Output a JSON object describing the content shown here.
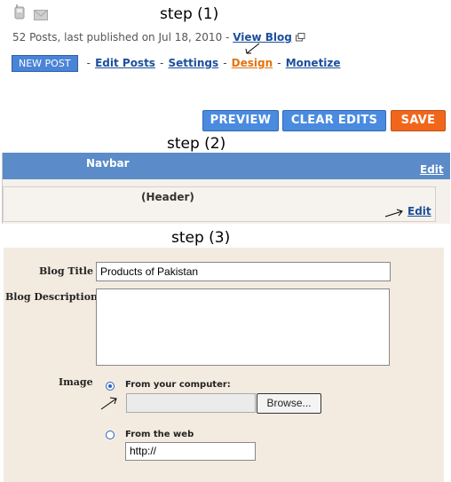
{
  "step1": {
    "label": "step (1)",
    "stats": "52 Posts, last published on Jul 18, 2010 -",
    "view_blog": "View Blog",
    "new_post": "NEW POST",
    "nav": [
      "Edit Posts",
      "Settings",
      "Design",
      "Monetize"
    ],
    "active_nav": "Design",
    "sep": "-"
  },
  "toolbar": {
    "preview": "PREVIEW",
    "clear_edits": "CLEAR EDITS",
    "save": "SAVE"
  },
  "step2": {
    "label": "step (2)",
    "navbar_title": "Navbar",
    "navbar_edit": "Edit",
    "header_title": "(Header)",
    "header_edit": "Edit"
  },
  "step3": {
    "label": "step (3)",
    "blog_title_label": "Blog Title",
    "blog_title_value": "Products of Pakistan",
    "blog_description_label": "Blog Description",
    "blog_description_value": "",
    "image_label": "Image",
    "from_computer": "From your computer:",
    "browse": "Browse...",
    "from_web": "From the web",
    "url_value": "http://",
    "selected_source": "From your computer:"
  },
  "colors": {
    "accent_blue": "#4a8be0",
    "save_orange": "#f0671c",
    "navbar_blue": "#5b8bc8",
    "link_blue": "#1c4f9c",
    "active_link": "#e3730f",
    "form_bg": "#f3ebe0"
  },
  "icons": [
    "phone-icon",
    "mail-icon",
    "external-window-icon",
    "arrow-annotation-icon"
  ]
}
